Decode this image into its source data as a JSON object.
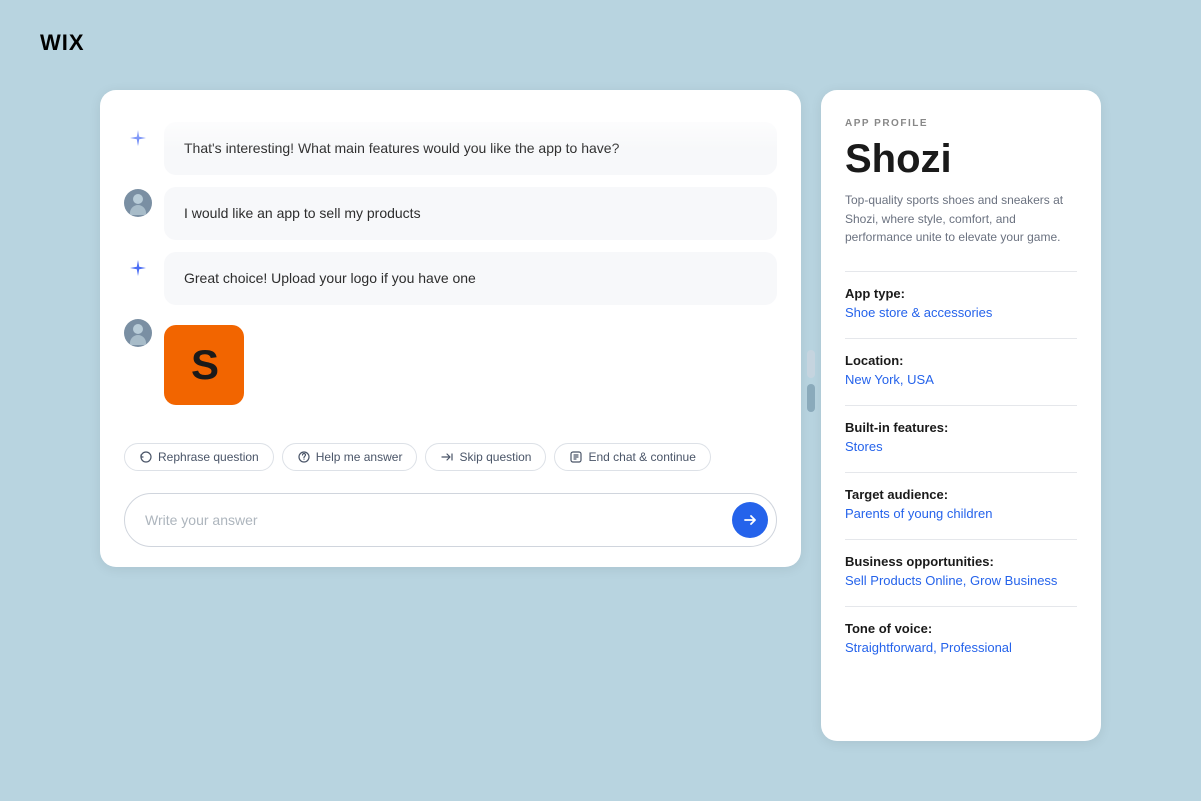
{
  "logo": {
    "text": "WIX"
  },
  "chat": {
    "messages": [
      {
        "id": "msg1",
        "type": "ai",
        "text": "That's interesting! What main features would you like the app to have?"
      },
      {
        "id": "msg2",
        "type": "user",
        "text": "I would like an app to sell my products"
      },
      {
        "id": "msg3",
        "type": "ai",
        "text": "Great choice!  Upload your logo if you have one"
      },
      {
        "id": "msg4",
        "type": "user_image",
        "logo_letter": "S"
      }
    ],
    "actions": [
      {
        "id": "rephrase",
        "label": "Rephrase question",
        "icon": "rephrase"
      },
      {
        "id": "help",
        "label": "Help me answer",
        "icon": "help"
      },
      {
        "id": "skip",
        "label": "Skip question",
        "icon": "skip"
      },
      {
        "id": "end",
        "label": "End chat & continue",
        "icon": "end"
      }
    ],
    "input_placeholder": "Write your answer",
    "send_button_label": "Send"
  },
  "profile": {
    "section_label": "APP PROFILE",
    "name": "Shozi",
    "description": "Top-quality sports shoes and sneakers at Shozi, where style, comfort, and performance unite to elevate your game.",
    "fields": [
      {
        "label": "App type:",
        "value": "Shoe store & accessories"
      },
      {
        "label": "Location:",
        "value": "New York, USA"
      },
      {
        "label": "Built-in features:",
        "value": "Stores"
      },
      {
        "label": "Target audience:",
        "value": "Parents of young children"
      },
      {
        "label": "Business opportunities:",
        "value": "Sell Products Online, Grow Business"
      },
      {
        "label": "Tone of voice:",
        "value": "Straightforward, Professional"
      }
    ]
  },
  "colors": {
    "bg": "#b8d4e0",
    "accent_blue": "#2563eb",
    "logo_orange": "#f26500"
  }
}
